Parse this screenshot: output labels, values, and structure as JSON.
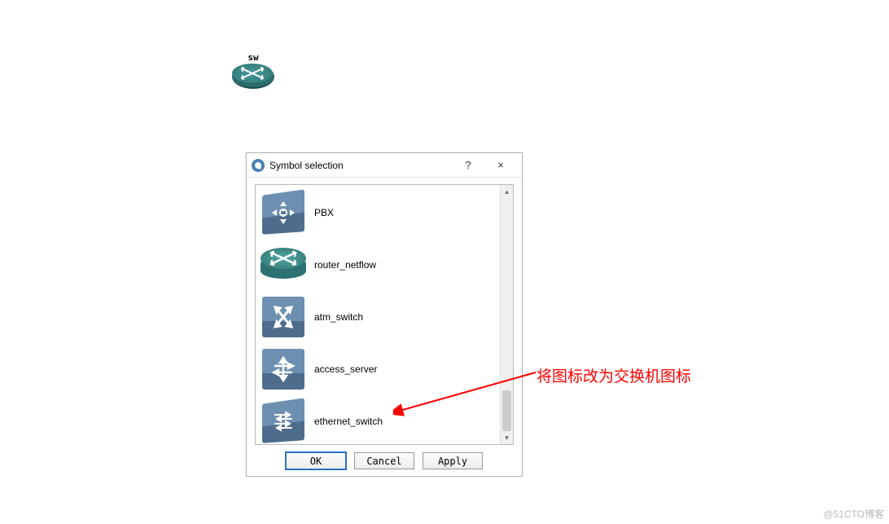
{
  "canvas": {
    "device_label": "sw"
  },
  "dialog": {
    "title": "Symbol selection",
    "help_label": "?",
    "close_label": "×",
    "items": [
      {
        "id": "pbx",
        "label": "PBX"
      },
      {
        "id": "router_netflow",
        "label": "router_netflow"
      },
      {
        "id": "atm_switch",
        "label": "atm_switch"
      },
      {
        "id": "access_server",
        "label": "access_server"
      },
      {
        "id": "ethernet_switch",
        "label": "ethernet_switch"
      }
    ],
    "buttons": {
      "ok": "OK",
      "cancel": "Cancel",
      "apply": "Apply"
    }
  },
  "annotation": {
    "text": "将图标改为交换机图标"
  },
  "watermark": "@51CTO博客"
}
